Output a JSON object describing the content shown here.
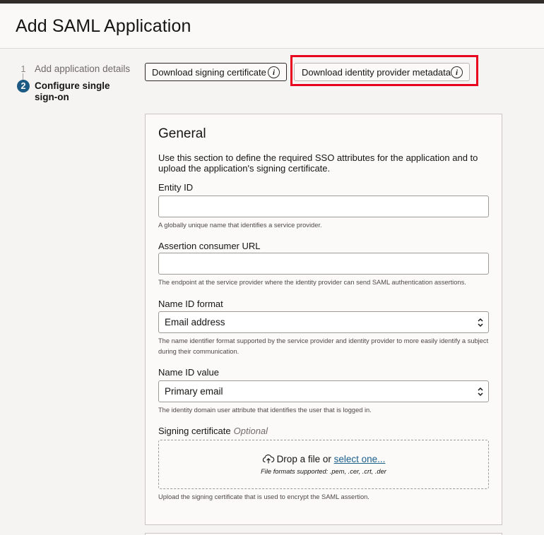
{
  "header": {
    "title": "Add SAML Application"
  },
  "steps": [
    {
      "number": "1",
      "label": "Add application details"
    },
    {
      "number": "2",
      "label": "Configure single sign-on"
    }
  ],
  "actions": {
    "download_signing_certificate": "Download signing certificate",
    "download_idp_metadata": "Download identity provider metadata",
    "info_glyph": "i"
  },
  "general": {
    "title": "General",
    "description": "Use this section to define the required SSO attributes for the application and to upload the application's signing certificate.",
    "entity_id": {
      "label": "Entity ID",
      "value": "",
      "help": "A globally unique name that identifies a service provider."
    },
    "acs_url": {
      "label": "Assertion consumer URL",
      "value": "",
      "help": "The endpoint at the service provider where the identity provider can send SAML authentication assertions."
    },
    "name_id_format": {
      "label": "Name ID format",
      "selected": "Email address",
      "help": "The name identifier format supported by the service provider and identity provider to more easily identify a subject during their communication."
    },
    "name_id_value": {
      "label": "Name ID value",
      "selected": "Primary email",
      "help": "The identity domain user attribute that identifies the user that is logged in."
    },
    "signing_certificate": {
      "label": "Signing certificate",
      "optional": "Optional",
      "drop_text": "Drop a file or",
      "select_link": "select one...",
      "formats": "File formats supported: .pem, .cer, .crt, .der",
      "help": "Upload the signing certificate that is used to encrypt the SAML assertion."
    }
  },
  "colors": {
    "accent": "#1d5a83",
    "highlight": "#e8001c",
    "link": "#1a5e8a"
  }
}
